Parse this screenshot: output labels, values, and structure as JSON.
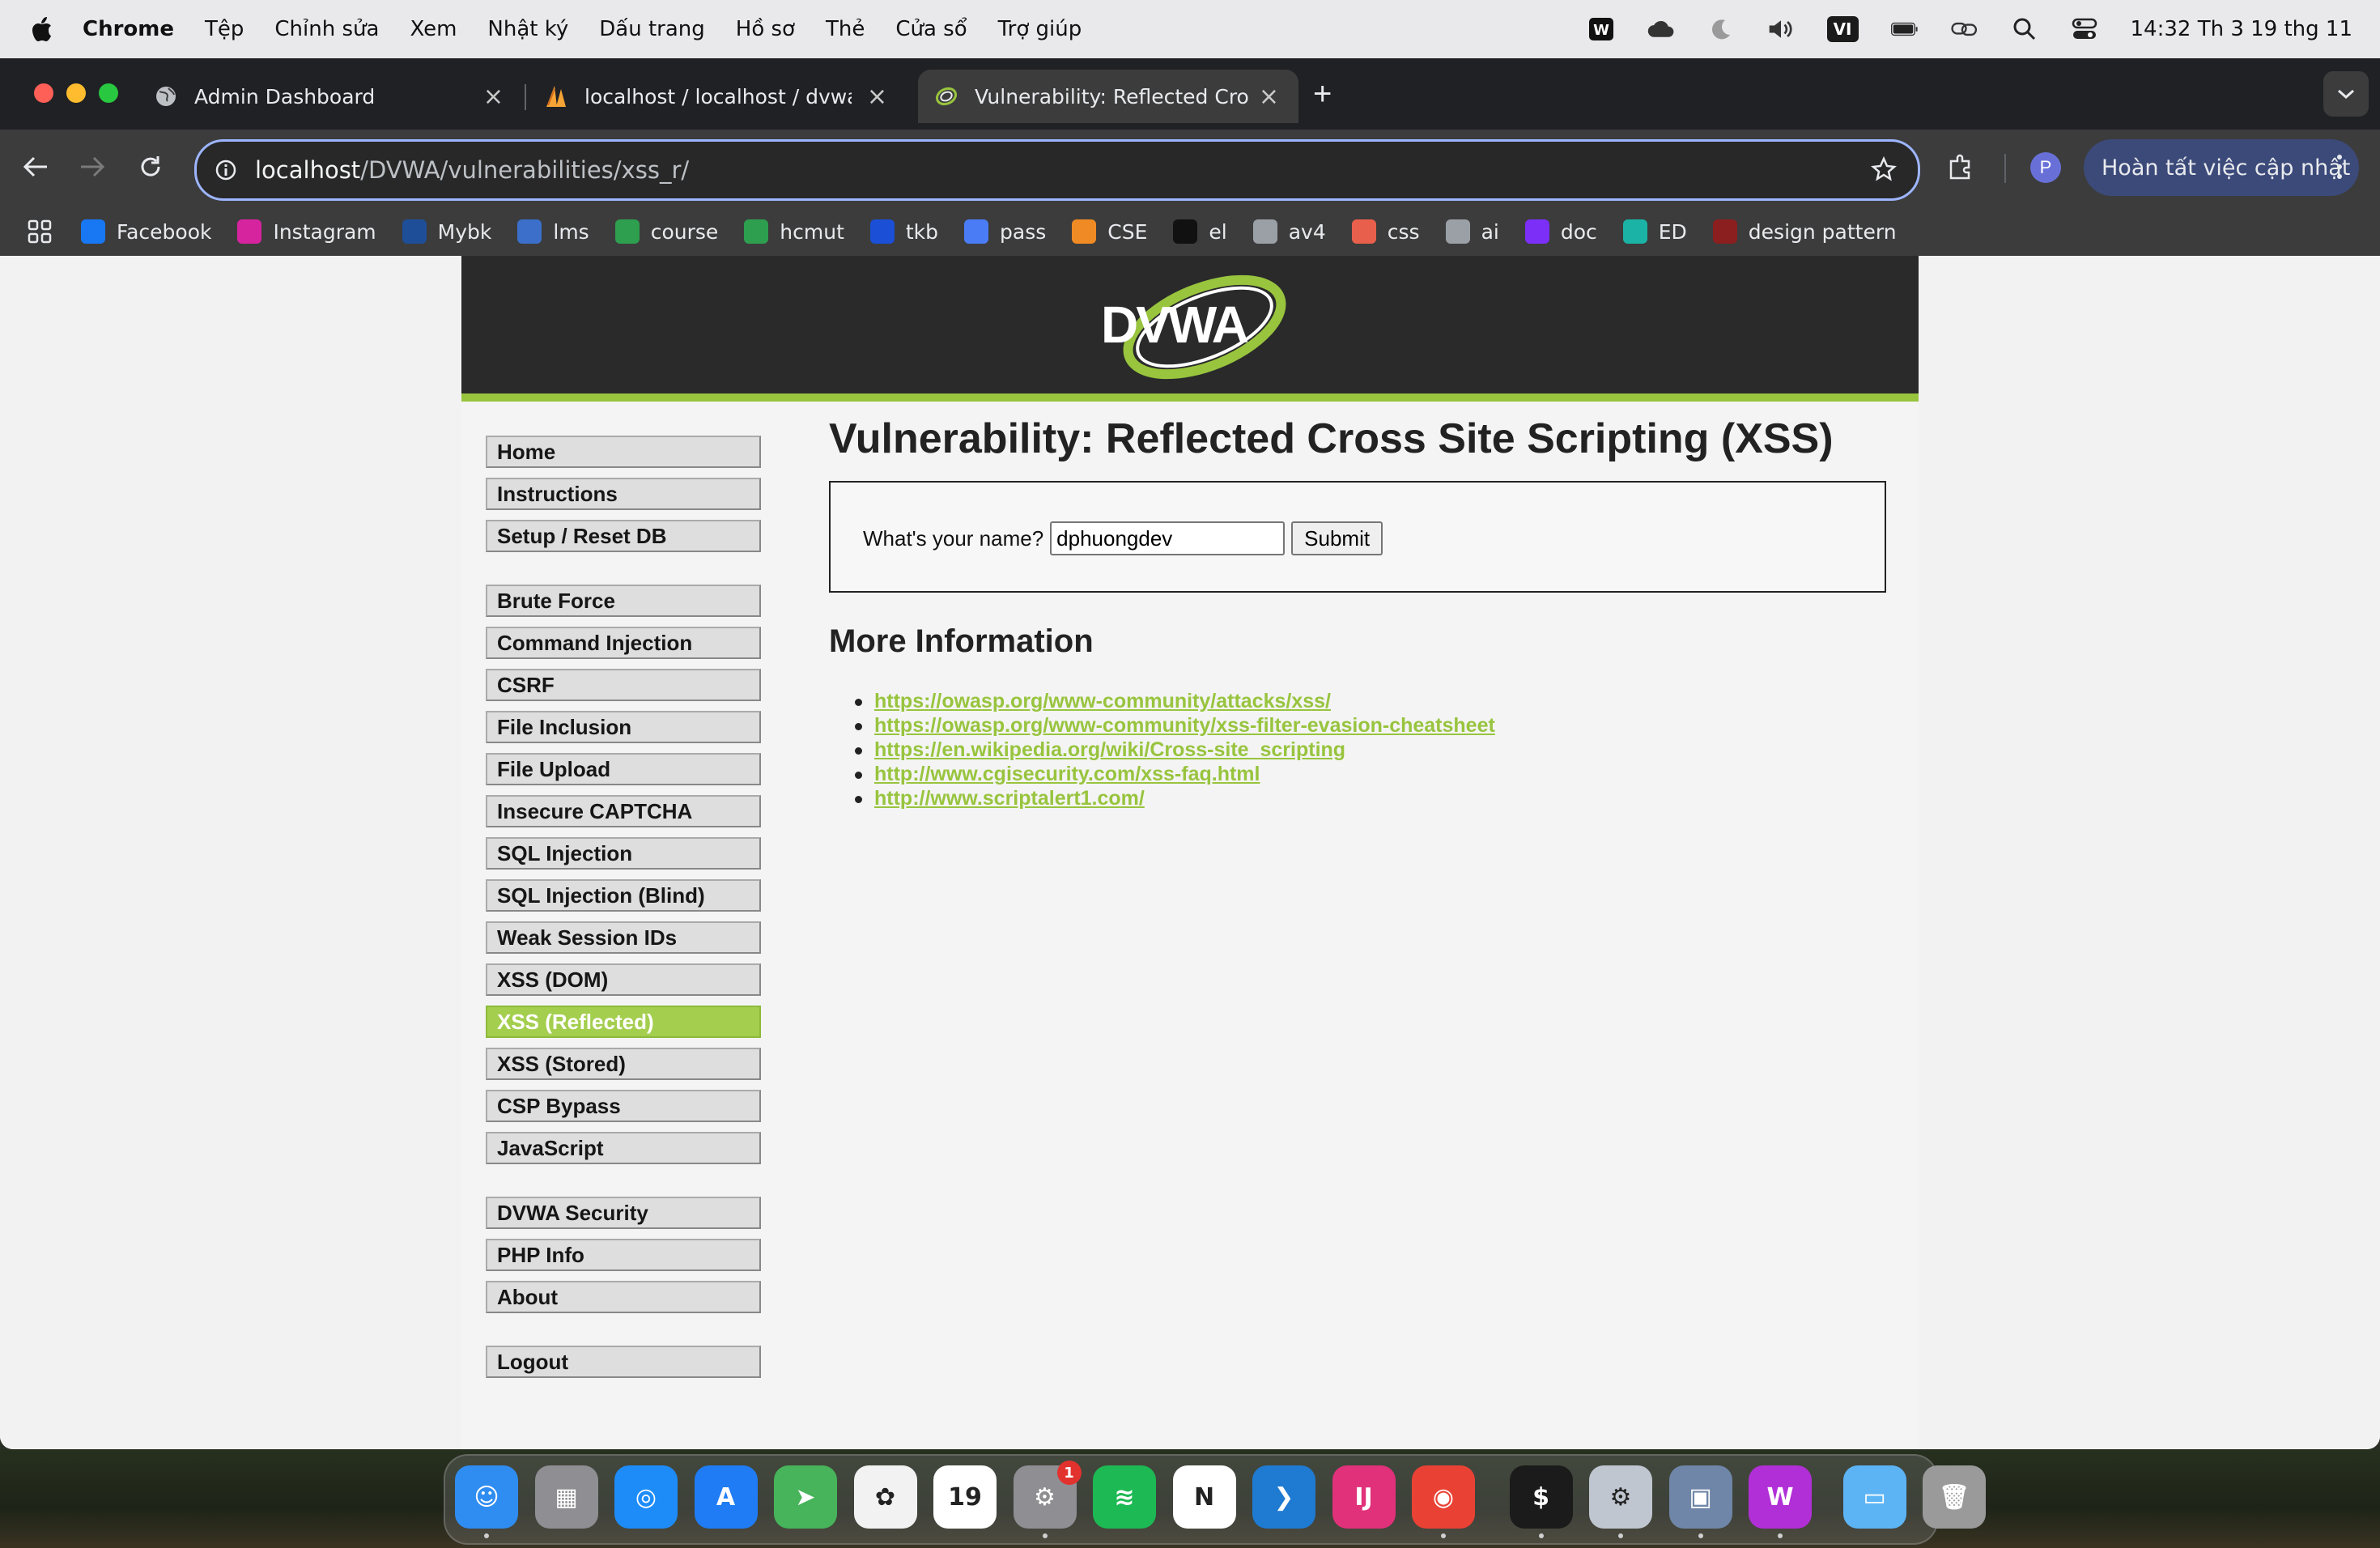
{
  "menubar": {
    "app_name": "Chrome",
    "items": [
      "Tệp",
      "Chỉnh sửa",
      "Xem",
      "Nhật ký",
      "Dấu trang",
      "Hồ sơ",
      "Thẻ",
      "Cửa sổ",
      "Trợ giúp"
    ],
    "input_source": "VI",
    "clock": "14:32 Th 3 19 thg 11"
  },
  "tabs": [
    {
      "title": "Admin Dashboard",
      "favicon": "globe-icon"
    },
    {
      "title": "localhost / localhost / dvwa | p",
      "favicon": "phpmyadmin-icon"
    },
    {
      "title": "Vulnerability: Reflected Cross",
      "favicon": "dvwa-icon"
    }
  ],
  "toolbar": {
    "url_host": "localhost",
    "url_path": "/DVWA/vulnerabilities/xss_r/",
    "profile_initial": "P",
    "update_label": "Hoàn tất việc cập nhật"
  },
  "bookmarks": [
    {
      "label": "Facebook",
      "icon": "facebook-icon",
      "color": "#1877f2"
    },
    {
      "label": "Instagram",
      "icon": "instagram-icon",
      "color": "#d6249f"
    },
    {
      "label": "Mybk",
      "icon": "mybk-icon",
      "color": "#1f4e99"
    },
    {
      "label": "lms",
      "icon": "lms-icon",
      "color": "#3b6fc9"
    },
    {
      "label": "course",
      "icon": "course-icon",
      "color": "#2e9e4f"
    },
    {
      "label": "hcmut",
      "icon": "hcmut-icon",
      "color": "#2e9e4f"
    },
    {
      "label": "tkb",
      "icon": "tkb-icon",
      "color": "#1a4fd6"
    },
    {
      "label": "pass",
      "icon": "docs-icon",
      "color": "#4a7cf5"
    },
    {
      "label": "CSE",
      "icon": "cse-icon",
      "color": "#f08a24"
    },
    {
      "label": "el",
      "icon": "el-icon",
      "color": "#111111"
    },
    {
      "label": "av4",
      "icon": "globe-icon",
      "color": "#9aa0a6"
    },
    {
      "label": "css",
      "icon": "css-icon",
      "color": "#e8604c"
    },
    {
      "label": "ai",
      "icon": "ai-icon",
      "color": "#9aa0a6"
    },
    {
      "label": "doc",
      "icon": "doc-icon",
      "color": "#7b2ff7"
    },
    {
      "label": "ED",
      "icon": "ed-icon",
      "color": "#1bb3a6"
    },
    {
      "label": "design pattern",
      "icon": "design-pattern-icon",
      "color": "#8b1f1f"
    }
  ],
  "dvwa": {
    "logo_text": "DVWA",
    "menu_groups": [
      [
        "Home",
        "Instructions",
        "Setup / Reset DB"
      ],
      [
        "Brute Force",
        "Command Injection",
        "CSRF",
        "File Inclusion",
        "File Upload",
        "Insecure CAPTCHA",
        "SQL Injection",
        "SQL Injection (Blind)",
        "Weak Session IDs",
        "XSS (DOM)",
        "XSS (Reflected)",
        "XSS (Stored)",
        "CSP Bypass",
        "JavaScript"
      ],
      [
        "DVWA Security",
        "PHP Info",
        "About"
      ],
      [
        "Logout"
      ]
    ],
    "selected_item": "XSS (Reflected)",
    "title": "Vulnerability: Reflected Cross Site Scripting (XSS)",
    "form": {
      "label": "What's your name?",
      "value": "dphuongdev",
      "submit": "Submit"
    },
    "more_info_heading": "More Information",
    "links": [
      "https://owasp.org/www-community/attacks/xss/",
      "https://owasp.org/www-community/xss-filter-evasion-cheatsheet",
      "https://en.wikipedia.org/wiki/Cross-site_scripting",
      "http://www.cgisecurity.com/xss-faq.html",
      "http://www.scriptalert1.com/"
    ],
    "accent_color": "#98c43e"
  },
  "dock": {
    "apps": [
      {
        "name": "finder-icon",
        "color": "#2f8cf0",
        "glyph": "☺"
      },
      {
        "name": "launchpad-icon",
        "color": "#8e8e93",
        "glyph": "▦"
      },
      {
        "name": "safari-icon",
        "color": "#1d8cf8",
        "glyph": "◎"
      },
      {
        "name": "app-store-icon",
        "color": "#1f7cf4",
        "glyph": "A"
      },
      {
        "name": "maps-icon",
        "color": "#47b35a",
        "glyph": "➤"
      },
      {
        "name": "photos-icon",
        "color": "#f2f2f2",
        "glyph": "✿"
      },
      {
        "name": "calendar-icon",
        "color": "#ffffff",
        "glyph": "19"
      },
      {
        "name": "system-settings-icon",
        "color": "#8e8e93",
        "glyph": "⚙"
      },
      {
        "name": "spotify-icon",
        "color": "#1db954",
        "glyph": "≋"
      },
      {
        "name": "notion-icon",
        "color": "#ffffff",
        "glyph": "N"
      },
      {
        "name": "vscode-icon",
        "color": "#1f7ad1",
        "glyph": "❯"
      },
      {
        "name": "intellij-icon",
        "color": "#e0317a",
        "glyph": "IJ"
      },
      {
        "name": "chrome-icon",
        "color": "#e94235",
        "glyph": "◉"
      },
      {
        "name": "terminal-icon",
        "color": "#1b1b1b",
        "glyph": "$"
      },
      {
        "name": "utility-icon",
        "color": "#c0c6d0",
        "glyph": "⚙"
      },
      {
        "name": "preview-icon",
        "color": "#6f86a8",
        "glyph": "▣"
      },
      {
        "name": "wps-icon",
        "color": "#b12fd6",
        "glyph": "W"
      },
      {
        "name": "downloads-folder-icon",
        "color": "#5db4f5",
        "glyph": "▭"
      },
      {
        "name": "trash-icon",
        "color": "#9a9a9a",
        "glyph": "🗑"
      }
    ],
    "settings_badge": "1"
  }
}
